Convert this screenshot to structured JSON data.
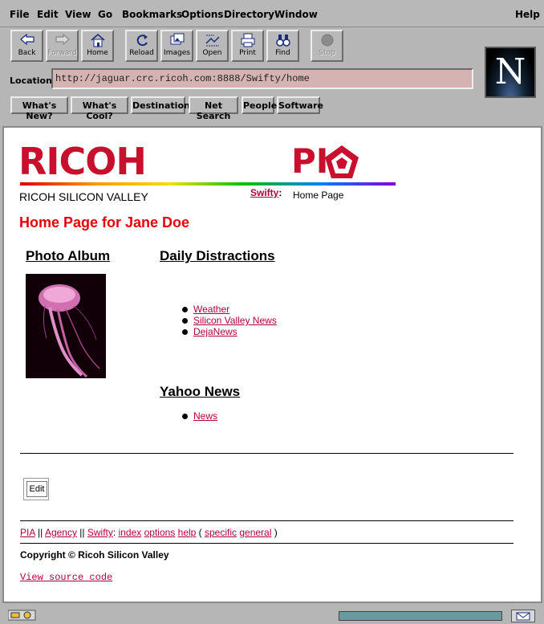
{
  "menu": [
    "File",
    "Edit",
    "View",
    "Go",
    "Bookmarks",
    "Options",
    "Directory",
    "Window",
    "Help"
  ],
  "toolbar": {
    "buttons": [
      {
        "label": "Back",
        "icon": "back-arrow-icon"
      },
      {
        "label": "Forward",
        "icon": "forward-arrow-icon"
      },
      {
        "label": "Home",
        "icon": "home-icon"
      },
      {
        "label": "Reload",
        "icon": "reload-icon"
      },
      {
        "label": "Images",
        "icon": "images-icon"
      },
      {
        "label": "Open",
        "icon": "open-icon"
      },
      {
        "label": "Print",
        "icon": "printer-icon"
      },
      {
        "label": "Find",
        "icon": "binoculars-icon"
      },
      {
        "label": "Stop",
        "icon": "stop-icon"
      }
    ],
    "logo_letter": "N"
  },
  "location": {
    "label": "Location:",
    "url": "http://jaguar.crc.ricoh.com:8888/Swifty/home"
  },
  "directory_buttons": [
    "What's New?",
    "What's Cool?",
    "Destinations",
    "Net Search",
    "People",
    "Software"
  ],
  "page": {
    "brand": "RICOH",
    "pia": "PI",
    "company_line": "RICOH SILICON VALLEY",
    "swifty_link": "Swifty",
    "swifty_sep": ":",
    "swifty_page": "Home Page",
    "heading": "Home Page for Jane Doe",
    "photo_album": "Photo Album",
    "daily_distractions": "Daily Distractions",
    "daily_links": [
      "Weather",
      "Silicon Valley News",
      "DejaNews"
    ],
    "yahoo_news": "Yahoo News",
    "yahoo_links": [
      "News"
    ],
    "edit_label": "Edit",
    "footer": {
      "pia": "PIA",
      "agency": "Agency",
      "swifty": "Swifty",
      "index": "index",
      "options": "options",
      "help": "help",
      "specific": "specific",
      "general": "general"
    },
    "copyright": "Copyright © Ricoh Silicon Valley",
    "view_source": "View source code"
  },
  "colors": {
    "brand_red": "#c8102e",
    "heading_red": "#e8000a",
    "link": "#b0003a",
    "location_bg": "#d6b3b3"
  }
}
